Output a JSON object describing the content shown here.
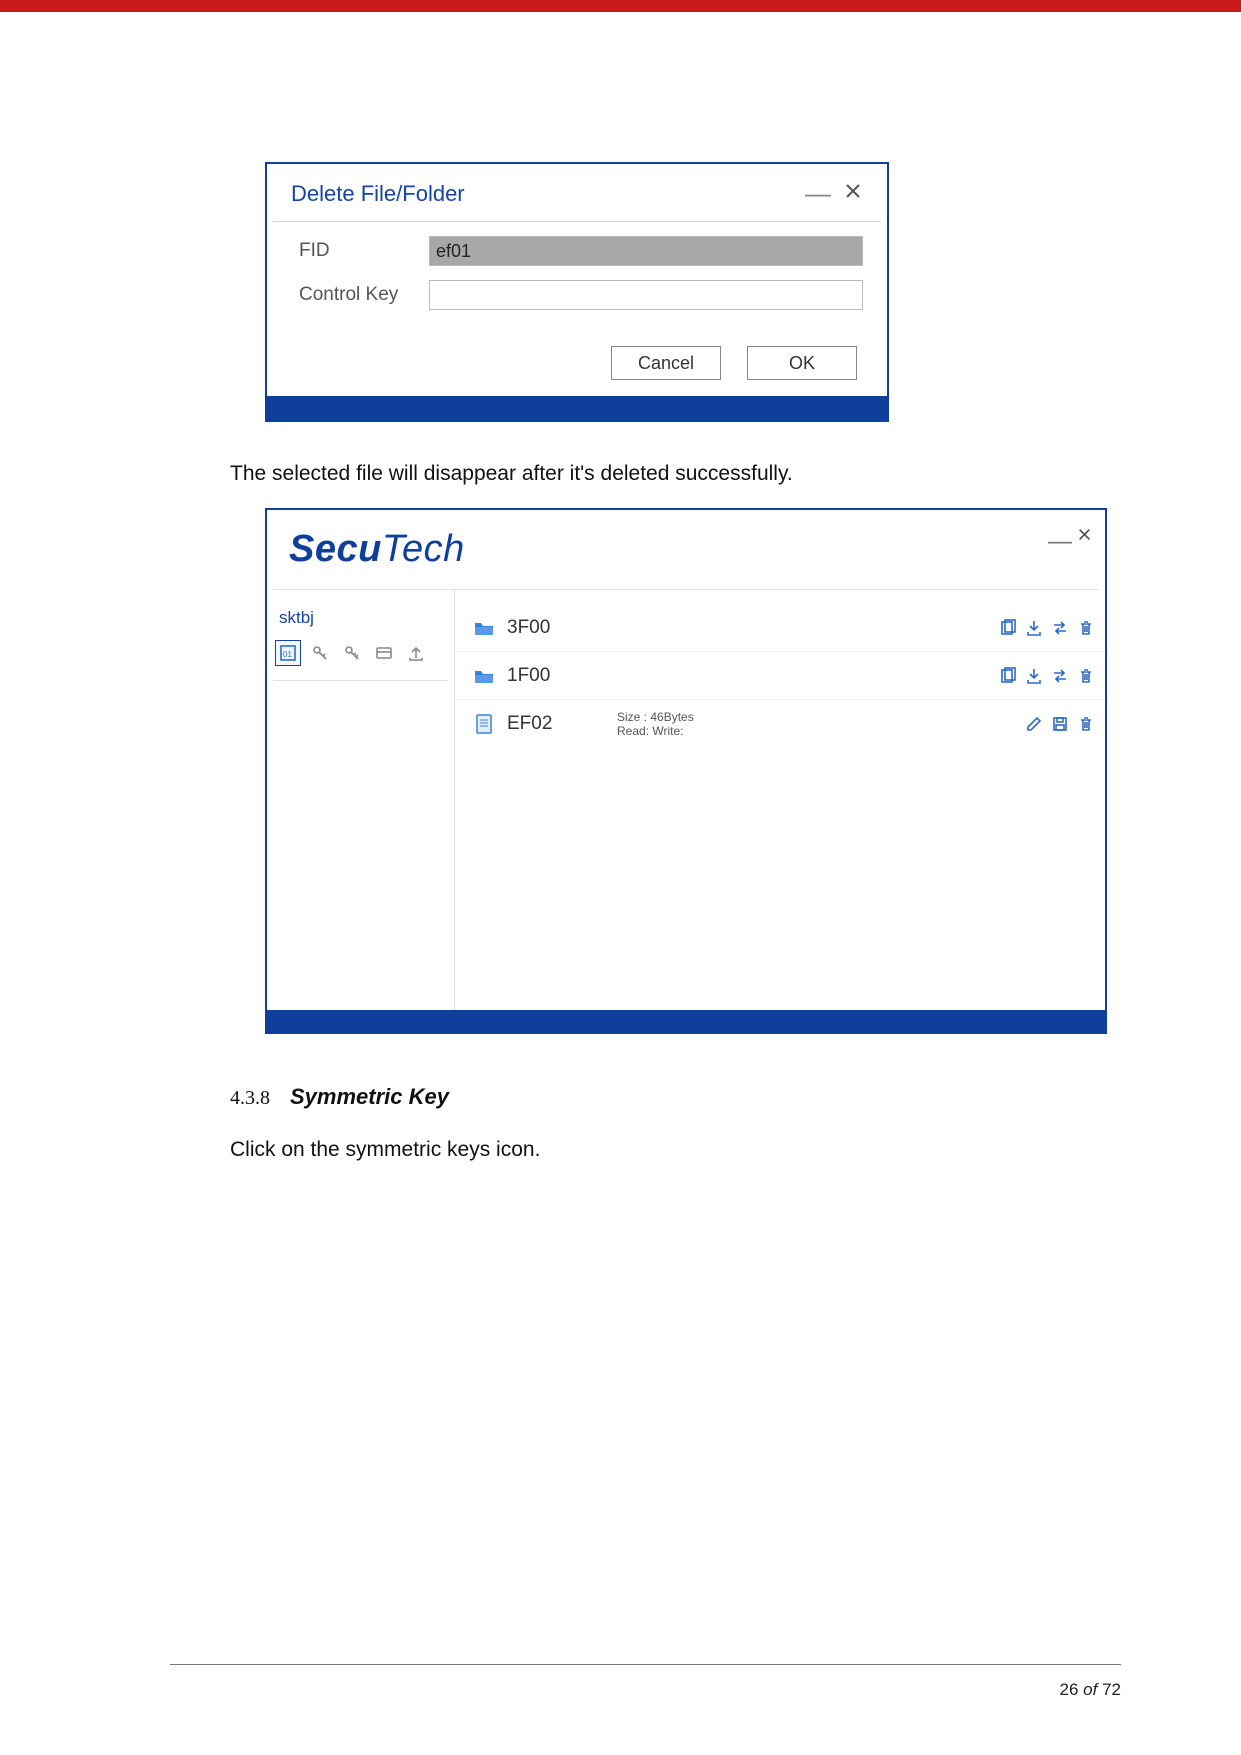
{
  "dialog1": {
    "title": "Delete File/Folder",
    "fields": {
      "fid_label": "FID",
      "fid_value": "ef01",
      "controlkey_label": "Control Key",
      "controlkey_value": ""
    },
    "buttons": {
      "cancel": "Cancel",
      "ok": "OK"
    }
  },
  "caption1": "The selected file will disappear after it's deleted successfully.",
  "dialog2": {
    "logo_main": "Secu",
    "logo_tail": "Tech",
    "sidebar_label": "sktbj",
    "rows": [
      {
        "name": "3F00",
        "type": "folder",
        "size_line": "",
        "rw_line": "",
        "actions": [
          "copy",
          "import",
          "transfer",
          "delete"
        ]
      },
      {
        "name": "1F00",
        "type": "folder",
        "size_line": "",
        "rw_line": "",
        "actions": [
          "copy",
          "import",
          "transfer",
          "delete"
        ]
      },
      {
        "name": "EF02",
        "type": "file",
        "size_line": "Size : 46Bytes",
        "rw_line": "Read:  Write:",
        "actions": [
          "edit",
          "save",
          "delete"
        ]
      }
    ]
  },
  "section": {
    "number": "4.3.8",
    "title": "Symmetric Key",
    "body": "Click on the symmetric keys icon."
  },
  "footer": {
    "page": "26",
    "of": "of",
    "total": "72"
  }
}
